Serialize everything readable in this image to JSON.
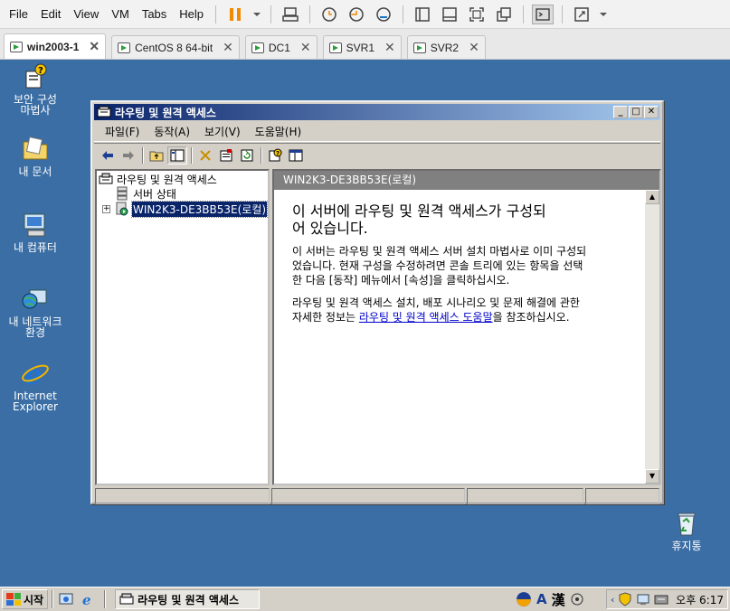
{
  "host": {
    "menu": [
      "File",
      "Edit",
      "View",
      "VM",
      "Tabs",
      "Help"
    ],
    "tabs": [
      {
        "label": "win2003-1",
        "active": true
      },
      {
        "label": "CentOS 8 64-bit",
        "active": false
      },
      {
        "label": "DC1",
        "active": false
      },
      {
        "label": "SVR1",
        "active": false
      },
      {
        "label": "SVR2",
        "active": false
      }
    ]
  },
  "desktop": {
    "icons": {
      "security_wizard": "보안 구성 마법사",
      "my_docs": "내 문서",
      "my_computer": "내 컴퓨터",
      "network": "내 네트워크 환경",
      "ie": "Internet Explorer",
      "recycle": "휴지통"
    }
  },
  "window": {
    "title": "라우팅 및 원격 액세스",
    "menu": [
      "파일(F)",
      "동작(A)",
      "보기(V)",
      "도움말(H)"
    ],
    "tree": {
      "root": "라우팅 및 원격 액세스",
      "server_status": "서버 상태",
      "server": "WIN2K3-DE3BB53E(로컬)"
    },
    "content": {
      "header": "WIN2K3-DE3BB53E(로컬)",
      "heading_line1": "이 서버에 라우팅 및 원격 액세스가 구성되",
      "heading_line2": "어 있습니다.",
      "p1_l1": "이 서버는 라우팅 및 원격 액세스 서버 설치 마법사로 이미 구성되",
      "p1_l2": "었습니다. 현재 구성을 수정하려면 콘솔 트리에 있는 항목을 선택",
      "p1_l3": "한 다음 [동작] 메뉴에서 [속성]을 클릭하십시오.",
      "p2_l1": "라우팅 및 원격 액세스 설치, 배포 시나리오 및 문제 해결에 관한",
      "p2_prefix": "자세한 정보는 ",
      "p2_link": "라우팅 및 원격 액세스 도움말",
      "p2_suffix": "을 참조하십시오."
    }
  },
  "taskbar": {
    "start": "시작",
    "task": "라우팅 및 원격 액세스",
    "lang_a": "A",
    "lang_han": "漢",
    "clock": "오후 6:17"
  }
}
